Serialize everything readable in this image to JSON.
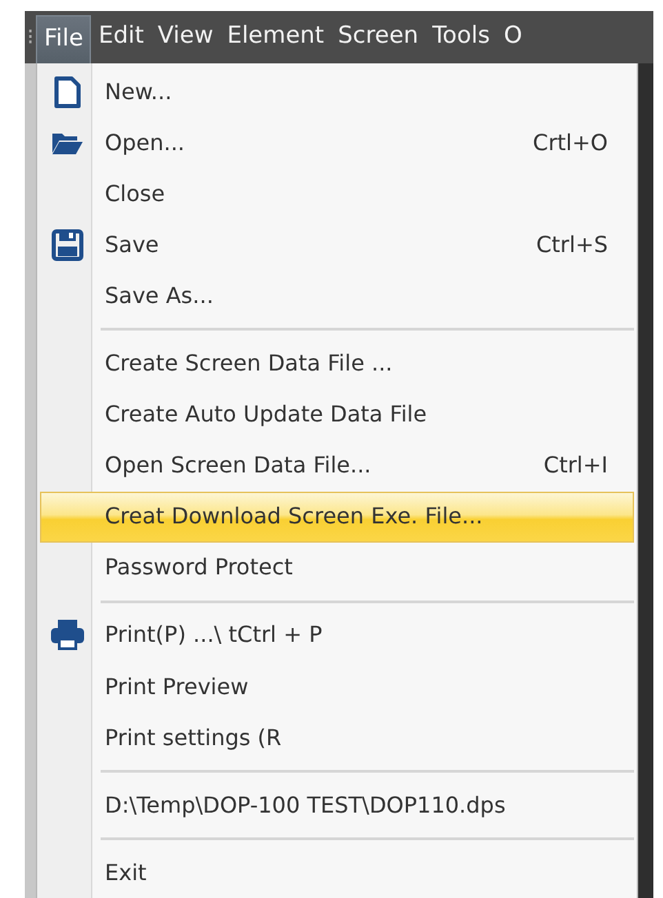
{
  "menubar": {
    "grip": "⁝",
    "items": [
      {
        "label": "File",
        "selected": true
      },
      {
        "label": "Edit",
        "selected": false
      },
      {
        "label": "View",
        "selected": false
      },
      {
        "label": "Element",
        "selected": false
      },
      {
        "label": "Screen",
        "selected": false
      },
      {
        "label": "Tools",
        "selected": false
      },
      {
        "label": "O",
        "selected": false
      }
    ]
  },
  "menu": {
    "entries": [
      {
        "kind": "item",
        "label": "New...",
        "selected": false
      },
      {
        "kind": "item",
        "label": "Open...",
        "shortcut": "Crtl+O",
        "selected": false
      },
      {
        "kind": "item",
        "label": "Close",
        "selected": false
      },
      {
        "kind": "item",
        "label": "Save",
        "shortcut": "Ctrl+S",
        "selected": false
      },
      {
        "kind": "item",
        "label": "Save As...",
        "selected": false
      },
      {
        "kind": "separator"
      },
      {
        "kind": "item",
        "label": "Create Screen Data File ...",
        "selected": false
      },
      {
        "kind": "item",
        "label": "Create Auto Update Data File",
        "selected": false
      },
      {
        "kind": "item",
        "label": "Open Screen Data File...",
        "shortcut": "Ctrl+I",
        "selected": false
      },
      {
        "kind": "item",
        "label": "Creat Download Screen Exe. File...",
        "selected": true
      },
      {
        "kind": "item",
        "label": "Password Protect",
        "selected": false
      },
      {
        "kind": "separator"
      },
      {
        "kind": "item",
        "label": "Print(P) ...\\ tCtrl + P",
        "selected": false
      },
      {
        "kind": "item",
        "label": "Print Preview",
        "selected": false
      },
      {
        "kind": "item",
        "label": "Print settings (R",
        "selected": false
      },
      {
        "kind": "separator"
      },
      {
        "kind": "item",
        "label": "D:\\Temp\\DOP-100 TEST\\DOP110.dps",
        "selected": false
      },
      {
        "kind": "separator"
      },
      {
        "kind": "item",
        "label": "Exit",
        "selected": false
      }
    ]
  }
}
